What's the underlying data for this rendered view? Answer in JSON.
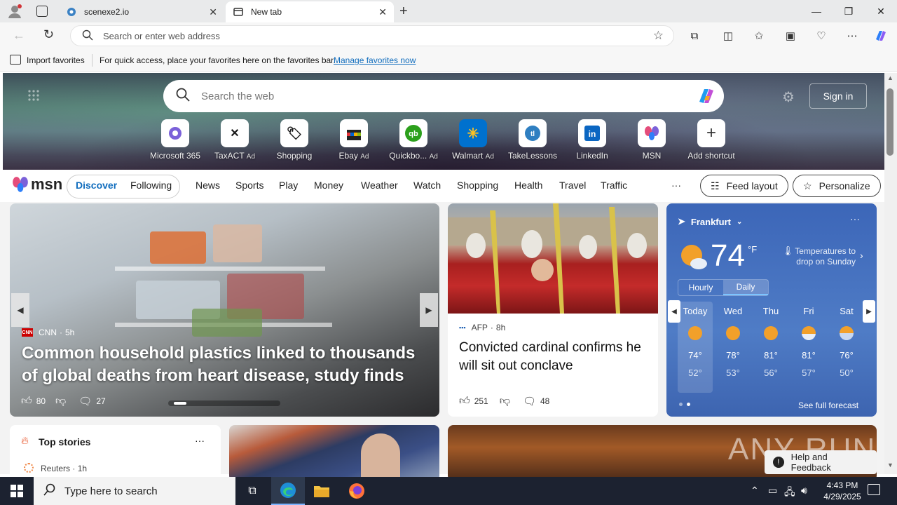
{
  "browser": {
    "tabs": [
      {
        "title": "scenexe2.io",
        "active": false
      },
      {
        "title": "New tab",
        "active": true
      }
    ],
    "address_placeholder": "Search or enter web address",
    "favorites_bar": {
      "import_label": "Import favorites",
      "message": "For quick access, place your favorites here on the favorites bar.",
      "manage_link": "Manage favorites now"
    }
  },
  "newtab": {
    "search_placeholder": "Search the web",
    "sign_in": "Sign in",
    "shortcuts": [
      {
        "label": "Microsoft 365",
        "ad": ""
      },
      {
        "label": "TaxACT",
        "ad": "Ad"
      },
      {
        "label": "Shopping",
        "ad": ""
      },
      {
        "label": "Ebay",
        "ad": "Ad"
      },
      {
        "label": "Quickbo...",
        "ad": "Ad"
      },
      {
        "label": "Walmart",
        "ad": "Ad"
      },
      {
        "label": "TakeLessons",
        "ad": ""
      },
      {
        "label": "LinkedIn",
        "ad": ""
      },
      {
        "label": "MSN",
        "ad": ""
      },
      {
        "label": "Add shortcut",
        "ad": ""
      }
    ]
  },
  "msn": {
    "logo": "msn",
    "tabs": [
      "Discover",
      "Following"
    ],
    "nav": [
      "News",
      "Sports",
      "Play",
      "Money",
      "Weather",
      "Watch",
      "Shopping",
      "Health",
      "Travel",
      "Traffic"
    ],
    "more": "···",
    "feed_layout": "Feed layout",
    "personalize": "Personalize"
  },
  "hero_story": {
    "source": "CNN",
    "age": "5h",
    "title": "Common household plastics linked to thousands of global deaths from heart disease, study finds",
    "likes": "80",
    "comments": "27"
  },
  "story2": {
    "source": "AFP",
    "age": "8h",
    "title": "Convicted cardinal confirms he will sit out conclave",
    "likes": "251",
    "comments": "48"
  },
  "weather": {
    "city": "Frankfurt",
    "temp": "74",
    "unit": "°F",
    "alert": "Temperatures to drop on Sunday",
    "tabs": [
      "Hourly",
      "Daily"
    ],
    "days": [
      {
        "day": "Today",
        "hi": "74°",
        "lo": "52°"
      },
      {
        "day": "Wed",
        "hi": "78°",
        "lo": "53°"
      },
      {
        "day": "Thu",
        "hi": "81°",
        "lo": "56°"
      },
      {
        "day": "Fri",
        "hi": "81°",
        "lo": "57°"
      },
      {
        "day": "Sat",
        "hi": "76°",
        "lo": "50°"
      }
    ],
    "forecast_link": "See full forecast"
  },
  "top_stories": {
    "title": "Top stories",
    "first_source": "Reuters",
    "first_age": "1h"
  },
  "help": "Help and Feedback",
  "watermark": "ANY RUN",
  "taskbar": {
    "search_placeholder": "Type here to search",
    "time": "4:43 PM",
    "date": "4/29/2025"
  }
}
